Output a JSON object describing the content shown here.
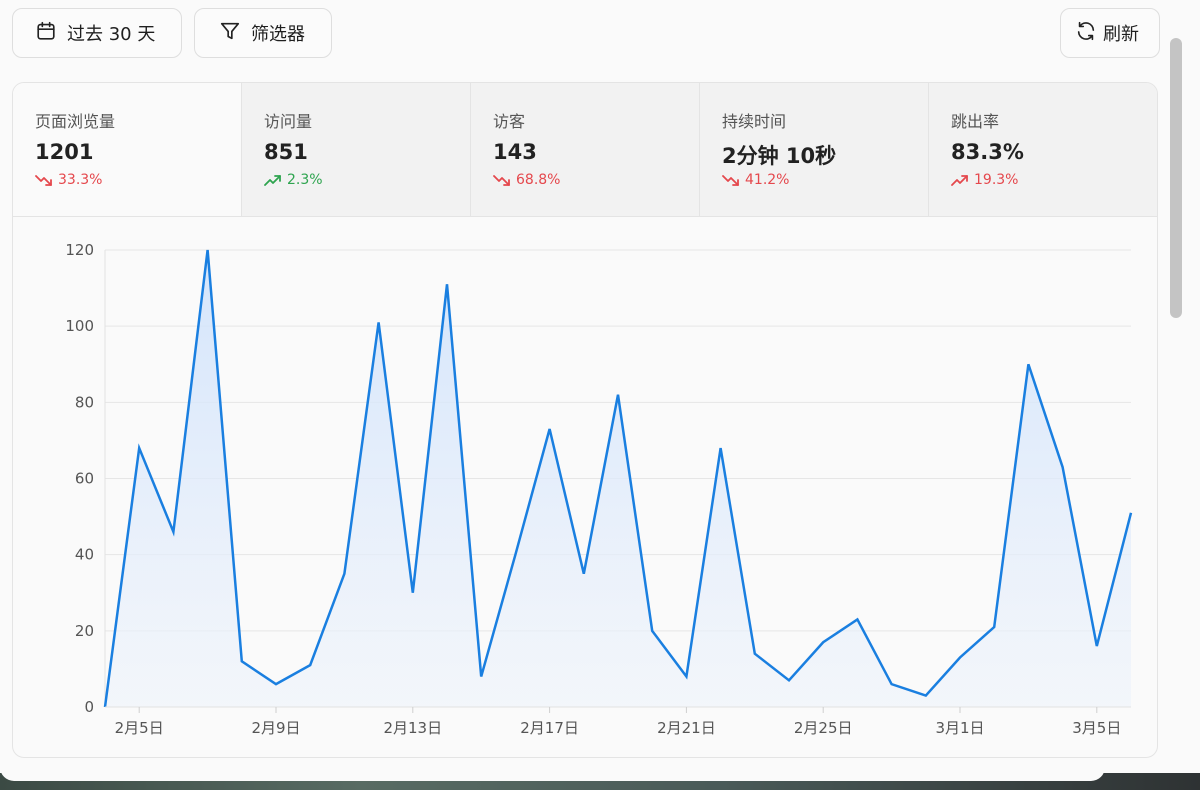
{
  "toolbar": {
    "range_label": "过去 30 天",
    "filter_label": "筛选器",
    "refresh_label": "刷新"
  },
  "stats": [
    {
      "label": "页面浏览量",
      "value": "1201",
      "delta": "33.3%",
      "trend": "down"
    },
    {
      "label": "访问量",
      "value": "851",
      "delta": "2.3%",
      "trend": "up-good"
    },
    {
      "label": "访客",
      "value": "143",
      "delta": "68.8%",
      "trend": "down"
    },
    {
      "label": "持续时间",
      "value": "2分钟 10秒",
      "delta": "41.2%",
      "trend": "down"
    },
    {
      "label": "跳出率",
      "value": "83.3%",
      "delta": "19.3%",
      "trend": "up-bad"
    }
  ],
  "colors": {
    "line": "#1a7fe0",
    "down": "#e5484d",
    "up_good": "#2ea44f",
    "up_bad": "#e5484d"
  },
  "chart_data": {
    "type": "area",
    "x": [
      "2月4日",
      "2月5日",
      "2月6日",
      "2月7日",
      "2月8日",
      "2月9日",
      "2月10日",
      "2月11日",
      "2月12日",
      "2月13日",
      "2月14日",
      "2月15日",
      "2月16日",
      "2月17日",
      "2月18日",
      "2月19日",
      "2月20日",
      "2月21日",
      "2月22日",
      "2月23日",
      "2月24日",
      "2月25日",
      "2月26日",
      "2月27日",
      "2月28日",
      "3月1日",
      "3月2日",
      "3月3日",
      "3月4日",
      "3月5日",
      "3月6日"
    ],
    "values": [
      0,
      68,
      46,
      120,
      12,
      6,
      11,
      35,
      101,
      30,
      111,
      8,
      40,
      73,
      35,
      82,
      20,
      8,
      68,
      14,
      7,
      17,
      23,
      6,
      3,
      13,
      21,
      90,
      63,
      16,
      51
    ],
    "x_tick_labels": [
      "2月5日",
      "2月9日",
      "2月13日",
      "2月17日",
      "2月21日",
      "2月25日",
      "3月1日",
      "3月5日"
    ],
    "x_tick_indices": [
      1,
      5,
      9,
      13,
      17,
      21,
      25,
      29
    ],
    "y_ticks": [
      0,
      20,
      40,
      60,
      80,
      100,
      120
    ],
    "ylim": [
      0,
      120
    ],
    "grid": true
  }
}
